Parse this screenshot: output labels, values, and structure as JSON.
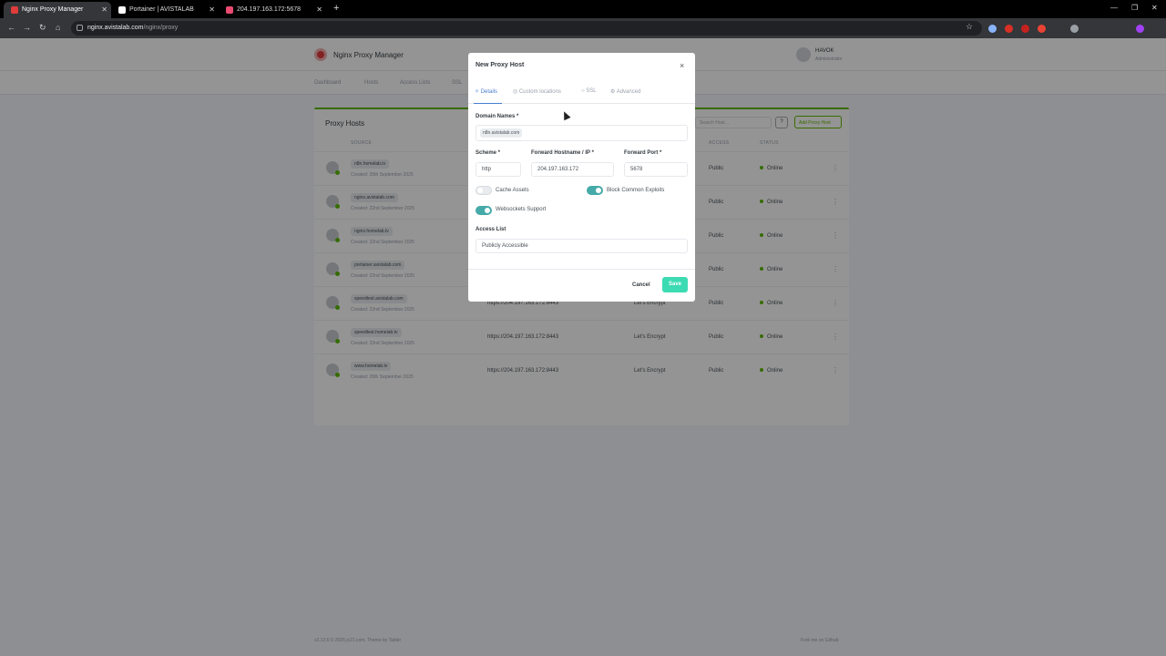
{
  "browser": {
    "tabs": [
      {
        "title": "Nginx Proxy Manager",
        "active": true,
        "color": "#e03c3c"
      },
      {
        "title": "Portainer | AVISTALAB",
        "active": false,
        "color": "#ffffff"
      },
      {
        "title": "204.197.163.172:5678",
        "active": false,
        "color": "#ea4b71"
      }
    ],
    "new_tab": "+",
    "url_host": "nginx.avistalab.com",
    "url_path": "/nginx/proxy"
  },
  "app": {
    "brand": "Nginx Proxy Manager",
    "user_name": "HAVOK",
    "user_role": "Administrator",
    "nav": [
      "Dashboard",
      "Hosts",
      "Access Lists",
      "SSL"
    ],
    "card_title": "Proxy Hosts",
    "search_placeholder": "Search Host…",
    "help_label": "?",
    "add_label": "Add Proxy Host",
    "columns": [
      "SOURCE",
      "ACCESS",
      "STATUS"
    ],
    "rows": [
      {
        "domain": "n8n.homelab.tv",
        "created": "Created: 25th September 2025",
        "dest": "",
        "ssl": "",
        "access": "Public",
        "status": "Online"
      },
      {
        "domain": "nginx.avistalab.com",
        "created": "Created: 22nd September 2025",
        "dest": "",
        "ssl": "",
        "access": "Public",
        "status": "Online"
      },
      {
        "domain": "nginx.homelab.tv",
        "created": "Created: 22nd September 2025",
        "dest": "",
        "ssl": "",
        "access": "Public",
        "status": "Online"
      },
      {
        "domain": "portainer.avistalab.com",
        "created": "Created: 22nd September 2025",
        "dest": "",
        "ssl": "",
        "access": "Public",
        "status": "Online"
      },
      {
        "domain": "speedtest.avistalab.com",
        "created": "Created: 22nd September 2025",
        "dest": "https://204.197.163.172:8443",
        "ssl": "Let's Encrypt",
        "access": "Public",
        "status": "Online"
      },
      {
        "domain": "speedtest.homelab.tv",
        "created": "Created: 22nd September 2025",
        "dest": "https://204.197.163.172:8443",
        "ssl": "Let's Encrypt",
        "access": "Public",
        "status": "Online"
      },
      {
        "domain": "www.homelab.tv",
        "created": "Created: 20th September 2025",
        "dest": "https://204.197.163.172:8443",
        "ssl": "Let's Encrypt",
        "access": "Public",
        "status": "Online"
      }
    ],
    "footer_left": "v2.12.6 © 2025 jc21.com. Theme by Tabler",
    "footer_right": "Fork me on Github"
  },
  "modal": {
    "title": "New Proxy Host",
    "close": "×",
    "tabs": [
      "Details",
      "Custom locations",
      "SSL",
      "Advanced"
    ],
    "domain_label": "Domain Names *",
    "domain_value": "n8n.avistalab.com",
    "scheme_label": "Scheme *",
    "scheme_value": "http",
    "host_label": "Forward Hostname / IP *",
    "host_value": "204.197.163.172",
    "port_label": "Forward Port *",
    "port_value": "5678",
    "cache_label": "Cache Assets",
    "cache_on": false,
    "exploits_label": "Block Common Exploits",
    "exploits_on": true,
    "ws_label": "Websockets Support",
    "ws_on": true,
    "access_label": "Access List",
    "access_value": "Publicly Accessible",
    "cancel": "Cancel",
    "save": "Save"
  }
}
